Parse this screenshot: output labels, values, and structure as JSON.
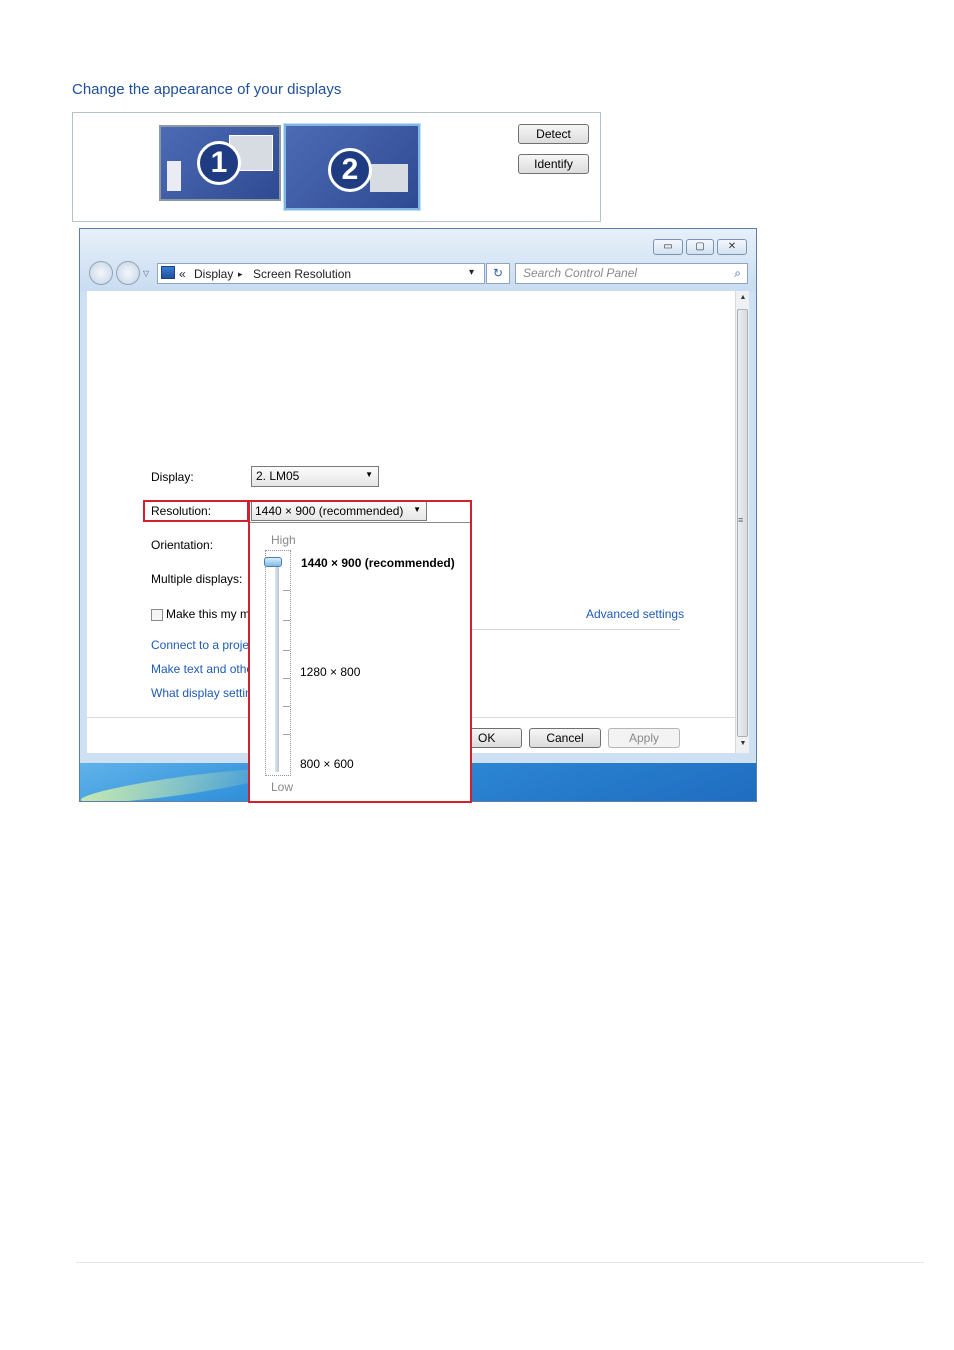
{
  "window": {
    "caption_buttons": {
      "minimize": "▭",
      "maximize": "▢",
      "close": "✕"
    },
    "address": {
      "chevrons": "«",
      "crumb1": "Display",
      "sep": "▸",
      "crumb2": "Screen Resolution",
      "dropdown": "▾"
    },
    "refresh_glyph": "↻",
    "search": {
      "placeholder": "Search Control Panel",
      "icon": "search-icon"
    }
  },
  "main": {
    "heading": "Change the appearance of your displays",
    "monitors": [
      "1",
      "2"
    ],
    "detect_label": "Detect",
    "identify_label": "Identify",
    "display_label": "Display:",
    "display_value": "2. LM05",
    "resolution_label": "Resolution:",
    "resolution_value": "1440 × 900 (recommended)",
    "orientation_label": "Orientation:",
    "multiple_label": "Multiple displays:",
    "checkbox_label": "Make this my m",
    "advanced_link": "Advanced settings",
    "links": [
      "Connect to a projec",
      "Make text and othe",
      "What display settin"
    ],
    "ok_label": "OK",
    "cancel_label": "Cancel",
    "apply_label": "Apply"
  },
  "popup": {
    "high_label": "High",
    "low_label": "Low",
    "options": [
      {
        "label": "1440 × 900 (recommended)",
        "selected": true
      },
      {
        "label": "1280 × 800",
        "selected": false
      },
      {
        "label": "800 × 600",
        "selected": false
      }
    ]
  },
  "colors": {
    "highlight": "#d2202e",
    "link": "#1e5bb8",
    "heading": "#1e4f9c"
  }
}
